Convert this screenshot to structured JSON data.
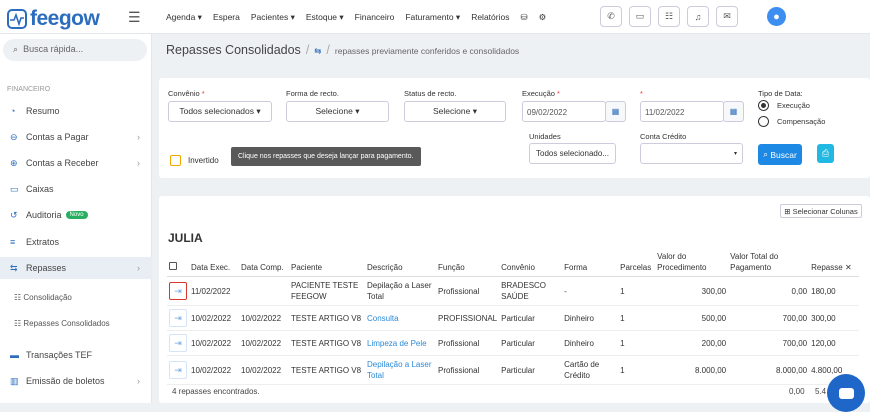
{
  "app": {
    "logo": "feegow"
  },
  "topnav": [
    "Agenda ▾",
    "Espera",
    "Pacientes ▾",
    "Estoque ▾",
    "Financeiro",
    "Faturamento ▾",
    "Relatórios"
  ],
  "search": {
    "placeholder": "Busca rápida..."
  },
  "sidebar": {
    "section": "FINANCEIRO",
    "items": [
      {
        "label": "Resumo",
        "icon": "pie-icon"
      },
      {
        "label": "Contas a Pagar",
        "icon": "minus-circle-icon"
      },
      {
        "label": "Contas a Receber",
        "icon": "plus-circle-icon"
      },
      {
        "label": "Caixas",
        "icon": "cash-icon"
      },
      {
        "label": "Auditoria",
        "icon": "audit-icon",
        "badge": "Novo"
      },
      {
        "label": "Extratos",
        "icon": "list-icon"
      },
      {
        "label": "Repasses",
        "icon": "transfer-icon"
      },
      {
        "label": "Transações TEF",
        "icon": "card-icon"
      },
      {
        "label": "Emissão de boletos",
        "icon": "barcode-icon"
      }
    ],
    "sub": [
      "Consolidação",
      "Repasses Consolidados"
    ]
  },
  "page": {
    "title": "Repasses Consolidados",
    "subtitle": "repasses previamente conferidos e consolidados"
  },
  "filters": {
    "convenio": {
      "label": "Convênio",
      "value": "Todos selecionados ▾"
    },
    "forma": {
      "label": "Forma de recto.",
      "value": "Selecione ▾"
    },
    "status": {
      "label": "Status de recto.",
      "value": "Selecione ▾"
    },
    "execucao": {
      "label": "Execução",
      "value": "09/02/2022"
    },
    "fim": {
      "value": "11/02/2022"
    },
    "tipo_data": {
      "label": "Tipo de Data:",
      "opt1": "Execução",
      "opt2": "Compensação"
    },
    "unidades": {
      "label": "Unidades",
      "value": "Todos selecionado..."
    },
    "conta": {
      "label": "Conta Crédito",
      "value": "▾"
    },
    "invertido": "Invertido",
    "tooltip": "Clique nos repasses que deseja lançar para pagamento.",
    "buscar": "Buscar"
  },
  "results": {
    "select_columns": "Selecionar Colunas",
    "group": "JULIA",
    "headers": [
      "Data Exec.",
      "Data Comp.",
      "Paciente",
      "Descrição",
      "Função",
      "Convênio",
      "Forma",
      "Parcelas",
      "Valor do Procedimento",
      "Valor Total do Pagamento",
      "Repasse"
    ],
    "rows": [
      {
        "exec": "11/02/2022",
        "comp": "",
        "paciente": "PACIENTE TESTE FEEGOW",
        "descricao": "Depilação a Laser Total",
        "funcao": "Profissional",
        "convenio": "BRADESCO SAÚDE",
        "forma": "-",
        "parcelas": "1",
        "valor_proc": "300,00",
        "valor_total": "0,00",
        "repasse": "180,00"
      },
      {
        "exec": "10/02/2022",
        "comp": "10/02/2022",
        "paciente": "TESTE ARTIGO V8",
        "descricao": "Consulta",
        "funcao": "PROFISSIONAL",
        "convenio": "Particular",
        "forma": "Dinheiro",
        "parcelas": "1",
        "valor_proc": "500,00",
        "valor_total": "700,00",
        "repasse": "300,00"
      },
      {
        "exec": "10/02/2022",
        "comp": "10/02/2022",
        "paciente": "TESTE ARTIGO V8",
        "descricao": "Limpeza de Pele",
        "funcao": "Profissional",
        "convenio": "Particular",
        "forma": "Dinheiro",
        "parcelas": "1",
        "valor_proc": "200,00",
        "valor_total": "700,00",
        "repasse": "120,00"
      },
      {
        "exec": "10/02/2022",
        "comp": "10/02/2022",
        "paciente": "TESTE ARTIGO V8",
        "descricao": "Depilação a Laser Total",
        "funcao": "Profissional",
        "convenio": "Particular",
        "forma": "Cartão de Crédito",
        "parcelas": "1",
        "valor_proc": "8.000,00",
        "valor_total": "8.000,00",
        "repasse": "4.800,00"
      }
    ],
    "footer": "4 repasses encontrados.",
    "sum_total": "0,00",
    "sum_repasse": "5.4"
  },
  "colors": {
    "brand": "#2c6dbd",
    "blue_button": "#1e88e5",
    "highlight": "#d9362f"
  }
}
